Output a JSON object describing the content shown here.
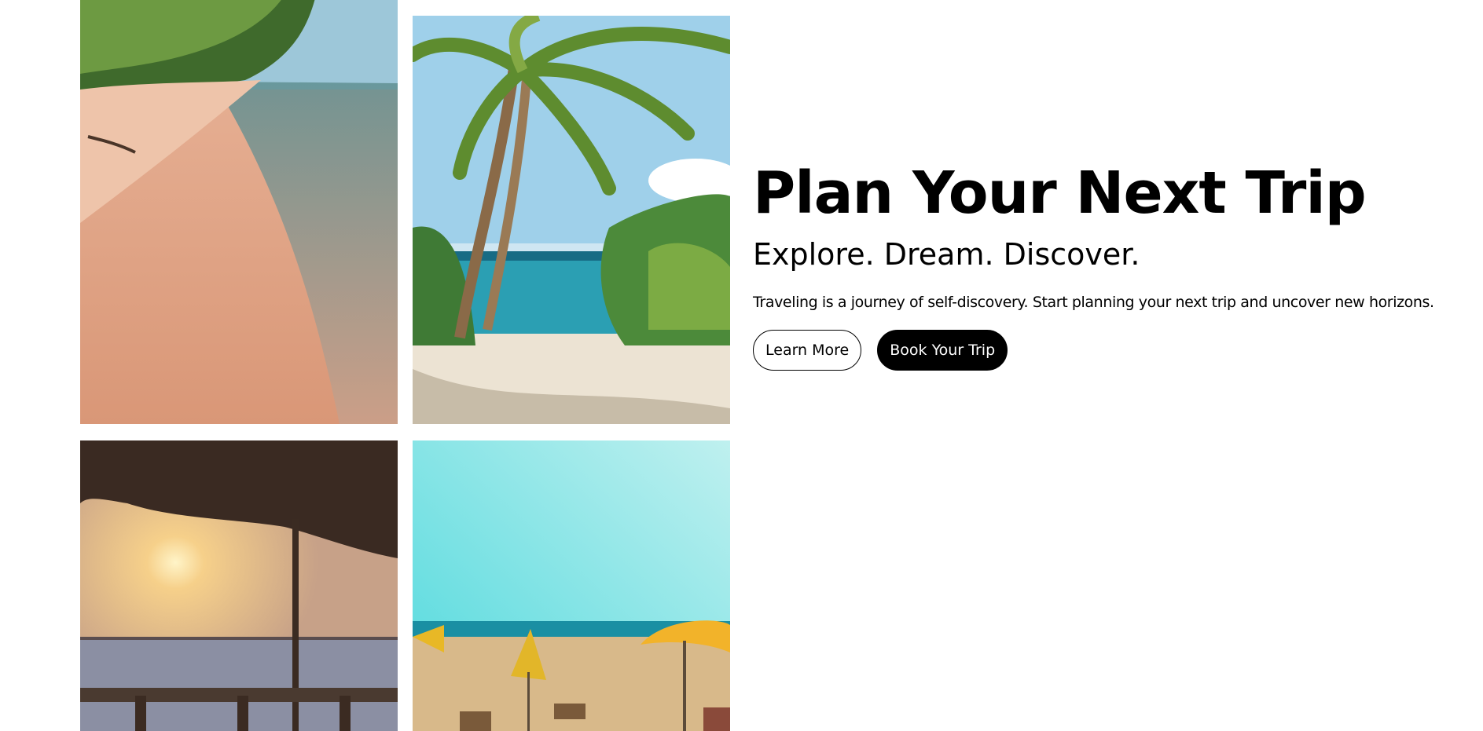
{
  "hero": {
    "title": "Plan Your Next Trip",
    "subtitle": "Explore. Dream. Discover.",
    "text": "Traveling is a journey of self-discovery. Start planning your next trip and uncover new horizons.",
    "learn_more_label": "Learn More",
    "book_label": "Book Your Trip"
  },
  "gallery": {
    "photos": [
      {
        "alt": "Sandy beach shoreline with palm forest",
        "icon": "beach-shore-photo"
      },
      {
        "alt": "Palm trees over a tropical beach and sea",
        "icon": "palm-beach-photo"
      },
      {
        "alt": "Sunset over the sea under a thatched hut",
        "icon": "sunset-hut-photo"
      },
      {
        "alt": "Beach with yellow umbrellas and turquoise sky",
        "icon": "umbrella-beach-photo"
      }
    ]
  },
  "colors": {
    "primary_button_bg": "#000000",
    "primary_button_text": "#ffffff",
    "secondary_button_border": "#000000"
  }
}
